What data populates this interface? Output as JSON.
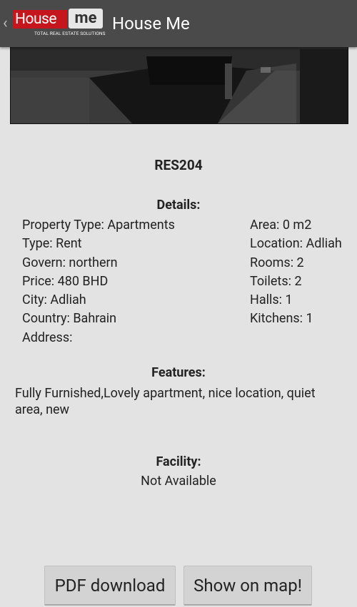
{
  "actionbar": {
    "logo_house": "House",
    "logo_me": "me",
    "logo_tagline": "TOTAL REAL ESTATE SOLUTIONS",
    "title": "House Me",
    "up_icon": "chevron-left-icon"
  },
  "property": {
    "ref_code": "RES204",
    "details_title": "Details:",
    "left": [
      "Property Type: Apartments",
      "Type: Rent",
      "Govern: northern",
      "Price: 480 BHD",
      "City: Adliah",
      "Country: Bahrain",
      "Address:"
    ],
    "right": [
      "Area: 0 m2",
      "Location: Adliah",
      "Rooms: 2",
      "Toilets: 2",
      "Halls: 1",
      "Kitchens: 1"
    ],
    "features_title": "Features:",
    "features_text": "Fully Furnished,Lovely apartment, nice location, quiet area, new",
    "facility_title": "Facility:",
    "facility_text": "Not Available"
  },
  "buttons": {
    "pdf_label": "PDF download",
    "map_label": "Show on map!"
  },
  "colors": {
    "actionbar_bg": "#4a4a4a",
    "page_bg": "#e3e3e3",
    "logo_red": "#c4161c",
    "button_bg": "#d3d3d3"
  }
}
